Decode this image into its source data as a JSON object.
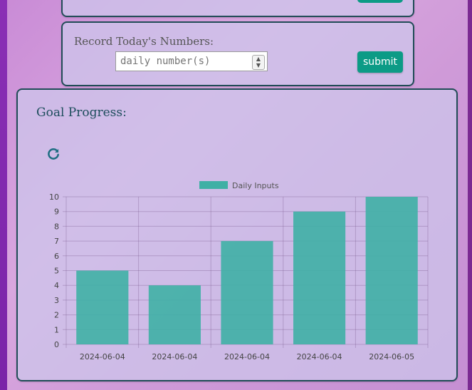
{
  "record": {
    "label": "Record Today's Numbers:",
    "input_placeholder": "daily number(s)",
    "submit_label": "submit"
  },
  "goal": {
    "title": "Goal Progress:"
  },
  "icons": {
    "refresh": "refresh-icon",
    "spinner": "spinner-icon"
  },
  "colors": {
    "accent": "#0c9b86",
    "bar": "#3fb0a5",
    "border": "#214c57"
  },
  "chart_data": {
    "type": "bar",
    "categories": [
      "2024-06-04",
      "2024-06-04",
      "2024-06-04",
      "2024-06-04",
      "2024-06-05"
    ],
    "series": [
      {
        "name": "Daily Inputs",
        "values": [
          5,
          4,
          7,
          9,
          10
        ]
      }
    ],
    "ylim": [
      0,
      10
    ],
    "yticks": [
      0,
      1,
      2,
      3,
      4,
      5,
      6,
      7,
      8,
      9,
      10
    ],
    "legend": "top-center",
    "grid": true
  }
}
